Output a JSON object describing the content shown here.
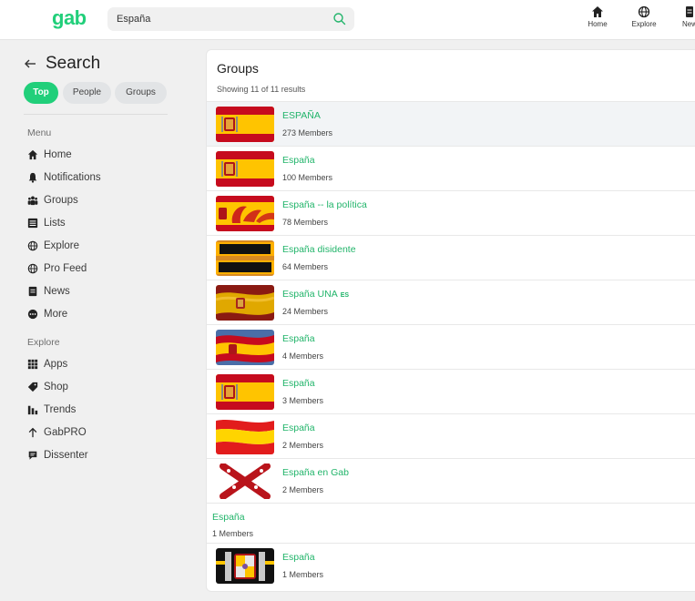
{
  "topbar": {
    "logo": "gab",
    "search_value": "España",
    "nav": [
      {
        "label": "Home",
        "icon": "home-icon"
      },
      {
        "label": "Explore",
        "icon": "globe-icon"
      },
      {
        "label": "New",
        "icon": "news-icon"
      }
    ]
  },
  "sidebar": {
    "title": "Search",
    "filters": [
      {
        "label": "Top",
        "active": true
      },
      {
        "label": "People",
        "active": false
      },
      {
        "label": "Groups",
        "active": false
      }
    ],
    "menu_label": "Menu",
    "menu": [
      {
        "label": "Home",
        "icon": "home-icon"
      },
      {
        "label": "Notifications",
        "icon": "bell-icon"
      },
      {
        "label": "Groups",
        "icon": "groups-icon"
      },
      {
        "label": "Lists",
        "icon": "list-icon"
      },
      {
        "label": "Explore",
        "icon": "globe-icon"
      },
      {
        "label": "Pro Feed",
        "icon": "globe-icon"
      },
      {
        "label": "News",
        "icon": "news-icon"
      },
      {
        "label": "More",
        "icon": "more-icon"
      }
    ],
    "explore_label": "Explore",
    "explore": [
      {
        "label": "Apps",
        "icon": "apps-grid-icon"
      },
      {
        "label": "Shop",
        "icon": "tag-icon"
      },
      {
        "label": "Trends",
        "icon": "trends-icon"
      },
      {
        "label": "GabPRO",
        "icon": "arrow-up-icon"
      },
      {
        "label": "Dissenter",
        "icon": "dissenter-icon"
      }
    ]
  },
  "main": {
    "title": "Groups",
    "subtitle": "Showing 11 of 11 results",
    "groups": [
      {
        "name": "ESPAÑA",
        "badge": "",
        "members": "273 Members",
        "thumb": "spain-flag-coat"
      },
      {
        "name": "España",
        "badge": "",
        "members": "100 Members",
        "thumb": "spain-flag-coat"
      },
      {
        "name": "España -- la política",
        "badge": "",
        "members": "78 Members",
        "thumb": "espa-script"
      },
      {
        "name": "España disidente",
        "badge": "",
        "members": "64 Members",
        "thumb": "spana-disidente-text"
      },
      {
        "name": "España UNA",
        "badge": "ES",
        "members": "24 Members",
        "thumb": "spain-flag-waving"
      },
      {
        "name": "España",
        "badge": "",
        "members": "4 Members",
        "thumb": "spain-flag-waving"
      },
      {
        "name": "España",
        "badge": "",
        "members": "3 Members",
        "thumb": "spain-flag-coat"
      },
      {
        "name": "España",
        "badge": "",
        "members": "2 Members",
        "thumb": "spain-flag-wave-plain"
      },
      {
        "name": "España en Gab",
        "badge": "",
        "members": "2 Members",
        "thumb": "burgundy-cross"
      },
      {
        "name": "España",
        "badge": "",
        "members": "1 Members",
        "thumb": ""
      },
      {
        "name": "España",
        "badge": "",
        "members": "1 Members",
        "thumb": "black-coat-of-arms"
      }
    ]
  },
  "colors": {
    "accent": "#21cf7a",
    "link": "#21b46a",
    "spain_red": "#c60b1e",
    "spain_yellow": "#ffc400"
  }
}
